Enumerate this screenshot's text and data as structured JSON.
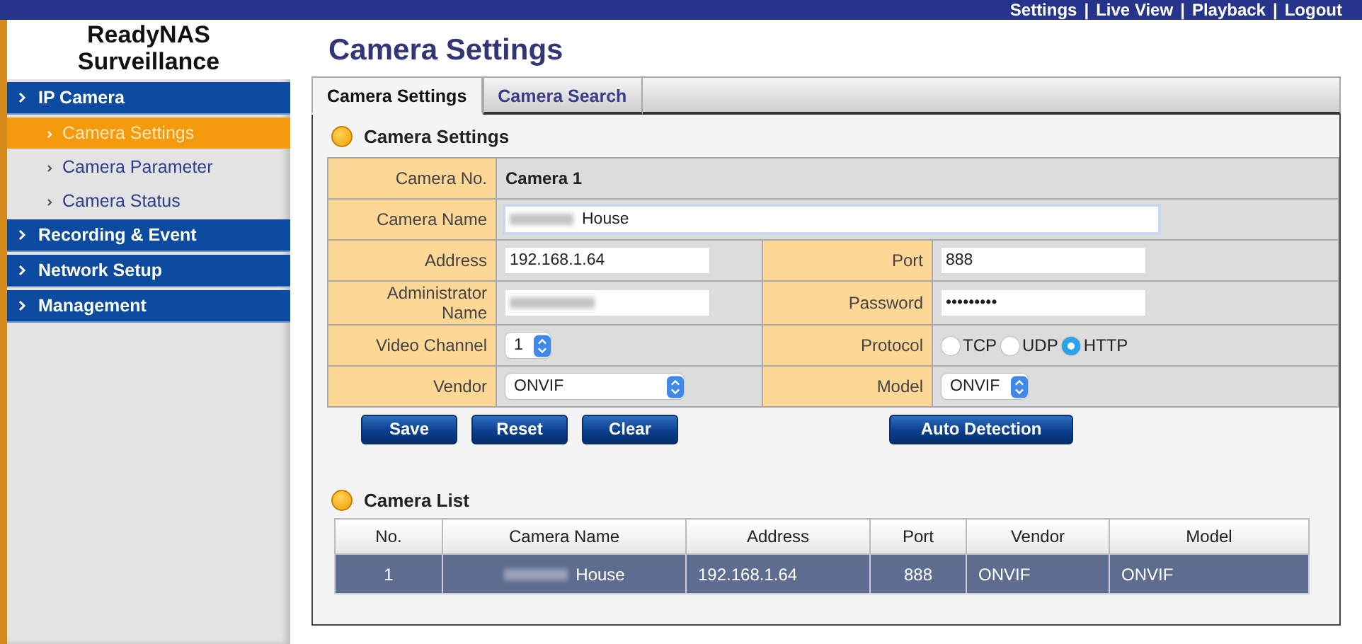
{
  "top_nav": {
    "separator": "|",
    "links": [
      {
        "label": "Settings"
      },
      {
        "label": "Live View"
      },
      {
        "label": "Playback"
      },
      {
        "label": "Logout"
      }
    ]
  },
  "logo": [
    "ReadyNAS",
    "Surveillance"
  ],
  "sidebar": {
    "items": [
      {
        "label": "IP Camera",
        "children": [
          {
            "label": "Camera Settings",
            "selected": true
          },
          {
            "label": "Camera Parameter",
            "selected": false
          },
          {
            "label": "Camera Status",
            "selected": false
          }
        ]
      },
      {
        "label": "Recording & Event"
      },
      {
        "label": "Network Setup"
      },
      {
        "label": "Management"
      }
    ]
  },
  "title": "Camera Settings",
  "tabs": [
    {
      "label": "Camera Settings",
      "selected": true
    },
    {
      "label": "Camera Search",
      "selected": false
    }
  ],
  "settings": {
    "heading": "Camera Settings",
    "rows": [
      {
        "cells": [
          {
            "label": "Camera No.",
            "kind": "text",
            "value": "Camera 1"
          }
        ]
      },
      {
        "cells": [
          {
            "label": "Camera Name",
            "kind": "wide-input",
            "value": "House",
            "redacted": true
          }
        ]
      },
      {
        "cells": [
          {
            "label": "Address",
            "kind": "input",
            "value": "192.168.1.64"
          },
          {
            "label": "Port",
            "kind": "input",
            "value": "888"
          }
        ]
      },
      {
        "cells": [
          {
            "label": "Administrator Name",
            "kind": "input",
            "redacted": true
          },
          {
            "label": "Password",
            "kind": "input",
            "value": "•••••••••"
          }
        ]
      },
      {
        "cells": [
          {
            "label": "Video Channel",
            "kind": "small-select",
            "value": "1"
          },
          {
            "label": "Protocol",
            "kind": "radio",
            "options": [
              {
                "label": "TCP",
                "selected": false
              },
              {
                "label": "UDP",
                "selected": false
              },
              {
                "label": "HTTP",
                "selected": true
              }
            ]
          }
        ]
      },
      {
        "cells": [
          {
            "label": "Vendor",
            "kind": "select",
            "value": "ONVIF"
          },
          {
            "label": "Model",
            "kind": "small-select",
            "value": "ONVIF"
          }
        ]
      }
    ],
    "buttons": [
      "Save",
      "Reset",
      "Clear"
    ],
    "detect_button": "Auto Detection"
  },
  "camera_list": {
    "heading": "Camera List",
    "columns": [
      "No.",
      "Camera Name",
      "Address",
      "Port",
      "Vendor",
      "Model"
    ],
    "rows": [
      {
        "selected": true,
        "name_redacted": true,
        "cells": [
          "1",
          "House",
          "192.168.1.64",
          "888",
          "ONVIF",
          "ONVIF"
        ]
      }
    ]
  }
}
